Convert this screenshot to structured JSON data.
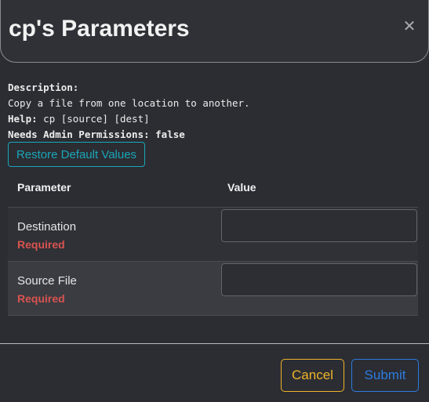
{
  "modal": {
    "title": "cp's Parameters",
    "close_symbol": "✕"
  },
  "description": {
    "description_label": "Description:",
    "description_text": "Copy a file from one location to another.",
    "help_label": "Help:",
    "help_text": " cp [source] [dest]",
    "admin_label": "Needs Admin Permissions:",
    "admin_text": " false"
  },
  "restore_button": "Restore Default Values",
  "table": {
    "headers": {
      "parameter": "Parameter",
      "value": "Value"
    },
    "rows": [
      {
        "name": "Destination",
        "required": "Required",
        "value": ""
      },
      {
        "name": "Source File",
        "required": "Required",
        "value": ""
      }
    ]
  },
  "footer": {
    "cancel_label": "Cancel",
    "submit_label": "Submit"
  },
  "colors": {
    "background": "#2b2d33",
    "accent_teal": "#1aa6b7",
    "required_red": "#d9534f",
    "cancel_yellow": "#f0b429",
    "submit_blue": "#2d7be0"
  },
  "icons": {
    "close": "close-icon"
  }
}
